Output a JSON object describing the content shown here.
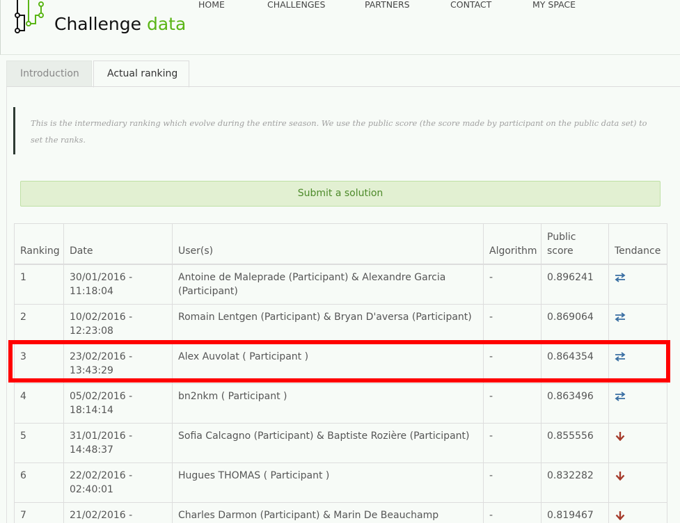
{
  "header": {
    "brand_main": "Challenge",
    "brand_accent": "data",
    "nav": [
      "HOME",
      "CHALLENGES",
      "PARTNERS",
      "CONTACT",
      "MY SPACE"
    ]
  },
  "tabs": [
    {
      "label": "Introduction",
      "active": false
    },
    {
      "label": "Actual ranking",
      "active": true
    }
  ],
  "intro_text": "This is the intermediary ranking which evolve during the entire season. We use the public score (the score made by participant on the public data set) to set the ranks.",
  "submit_label": "Submit a solution",
  "table": {
    "columns": [
      "Ranking",
      "Date",
      "User(s)",
      "Algorithm",
      "Public score",
      "Tendance"
    ],
    "rows": [
      {
        "rank": "1",
        "date": "30/01/2016 - 11:18:04",
        "users": "Antoine de Maleprade (Participant) & Alexandre Garcia (Participant)",
        "algorithm": "-",
        "score": "0.896241",
        "tendance": "stable"
      },
      {
        "rank": "2",
        "date": "10/02/2016 - 12:23:08",
        "users": "Romain Lentgen (Participant) & Bryan D'aversa (Participant)",
        "algorithm": "-",
        "score": "0.869064",
        "tendance": "stable"
      },
      {
        "rank": "3",
        "date": "23/02/2016 - 13:43:29",
        "users": "Alex Auvolat ( Participant )",
        "algorithm": "-",
        "score": "0.864354",
        "tendance": "stable"
      },
      {
        "rank": "4",
        "date": "05/02/2016 - 18:14:14",
        "users": "bn2nkm ( Participant )",
        "algorithm": "-",
        "score": "0.863496",
        "tendance": "stable"
      },
      {
        "rank": "5",
        "date": "31/01/2016 - 14:48:37",
        "users": "Sofia Calcagno (Participant) & Baptiste Rozière (Participant)",
        "algorithm": "-",
        "score": "0.855556",
        "tendance": "down"
      },
      {
        "rank": "6",
        "date": "22/02/2016 - 02:40:01",
        "users": "Hugues THOMAS ( Participant )",
        "algorithm": "-",
        "score": "0.832282",
        "tendance": "down"
      },
      {
        "rank": "7",
        "date": "21/02/2016 -",
        "users": "Charles Darmon (Participant) & Marin De Beauchamp",
        "algorithm": "-",
        "score": "0.819467",
        "tendance": "down"
      }
    ]
  },
  "colors": {
    "accent": "#5ab516",
    "stable_icon": "#3a6fa3",
    "down_icon": "#a53a2a",
    "highlight": "#ff0000"
  },
  "icons": {
    "stable": "exchange-arrows-icon",
    "down": "arrow-down-icon"
  }
}
